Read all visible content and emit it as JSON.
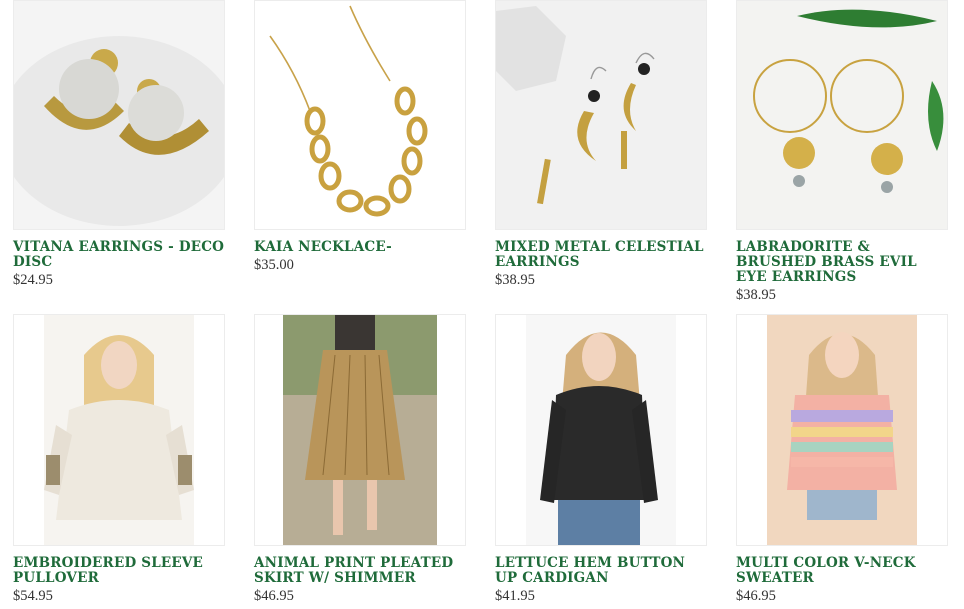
{
  "products": [
    {
      "title": "VITANA EARRINGS - DECO DISC",
      "price": "$24.95",
      "image": "hammered-disc-earrings"
    },
    {
      "title": "KAIA NECKLACE-",
      "price": "$35.00",
      "image": "gold-chain-necklace"
    },
    {
      "title": "MIXED METAL CELESTIAL EARRINGS",
      "price": "$38.95",
      "image": "moon-star-earrings"
    },
    {
      "title": "LABRADORITE & BRUSHED BRASS EVIL EYE EARRINGS",
      "price": "$38.95",
      "image": "hoop-sunburst-earrings"
    },
    {
      "title": "EMBROIDERED SLEEVE PULLOVER",
      "price": "$54.95",
      "image": "cream-pullover-model"
    },
    {
      "title": "ANIMAL PRINT PLEATED SKIRT W/ SHIMMER",
      "price": "$46.95",
      "image": "pleated-skirt-model"
    },
    {
      "title": "LETTUCE HEM BUTTON UP CARDIGAN",
      "price": "$41.95",
      "image": "black-cardigan-model"
    },
    {
      "title": "MULTI COLOR V-NECK SWEATER",
      "price": "$46.95",
      "image": "striped-sweater-model"
    }
  ],
  "colors": {
    "title": "#1f6b3a",
    "price": "#333333"
  }
}
